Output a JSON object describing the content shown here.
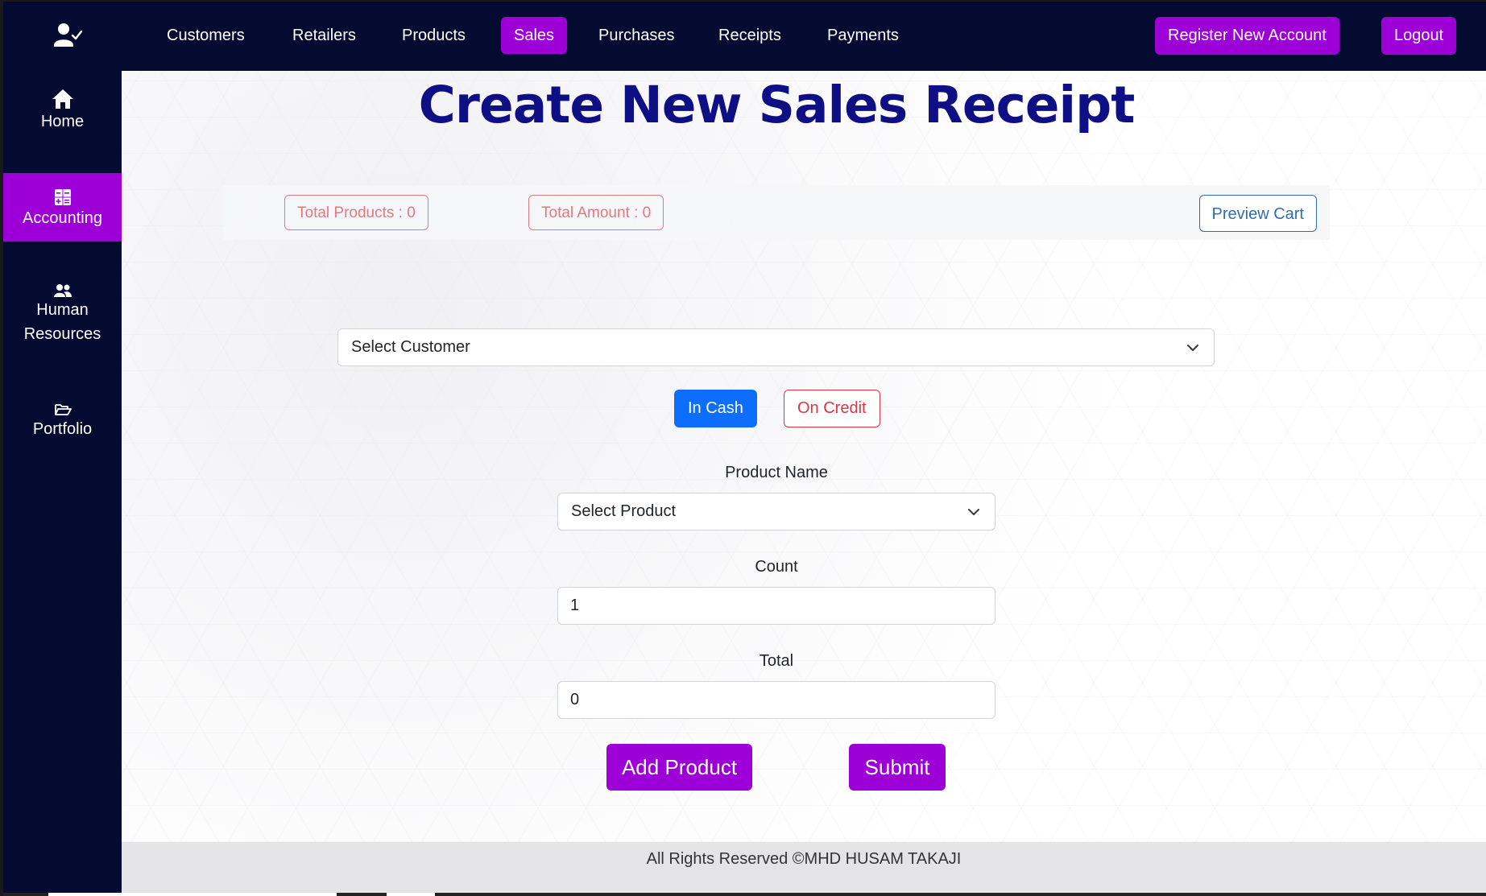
{
  "nav": {
    "brand_icon": "user-check-icon",
    "items": [
      {
        "label": "Customers",
        "active": false
      },
      {
        "label": "Retailers",
        "active": false
      },
      {
        "label": "Products",
        "active": false
      },
      {
        "label": "Sales",
        "active": true
      },
      {
        "label": "Purchases",
        "active": false
      },
      {
        "label": "Receipts",
        "active": false
      },
      {
        "label": "Payments",
        "active": false
      }
    ],
    "register_label": "Register New Account",
    "logout_label": "Logout"
  },
  "sidebar": {
    "items": [
      {
        "label": "Home",
        "icon": "home-icon",
        "active": false
      },
      {
        "label": "Accounting",
        "icon": "calculator-icon",
        "active": true
      },
      {
        "label": "Human Resources",
        "icon": "people-icon",
        "active": false
      },
      {
        "label": "Portfolio",
        "icon": "folder-open-icon",
        "active": false
      }
    ]
  },
  "page": {
    "title": "Create New Sales Receipt"
  },
  "summary": {
    "total_products": "Total Products : 0",
    "total_amount": "Total Amount : 0",
    "preview_cart": "Preview Cart"
  },
  "form": {
    "customer_select": "Select Customer",
    "payment": {
      "cash_label": "In Cash",
      "credit_label": "On Credit",
      "selected": "In Cash"
    },
    "product_label": "Product Name",
    "product_select": "Select Product",
    "count_label": "Count",
    "count_value": "1",
    "total_label": "Total",
    "total_value": "0",
    "add_product_label": "Add Product",
    "submit_label": "Submit"
  },
  "footer": {
    "text": "All Rights Reserved ©MHD HUSAM TAKAJI"
  },
  "colors": {
    "nav_bg": "#050a30",
    "accent": "#9d00d6",
    "title": "#0f0f85",
    "primary": "#0d6efd",
    "danger": "#dc3545",
    "badge": "#e07a80",
    "outline_primary": "#2f6db6"
  }
}
